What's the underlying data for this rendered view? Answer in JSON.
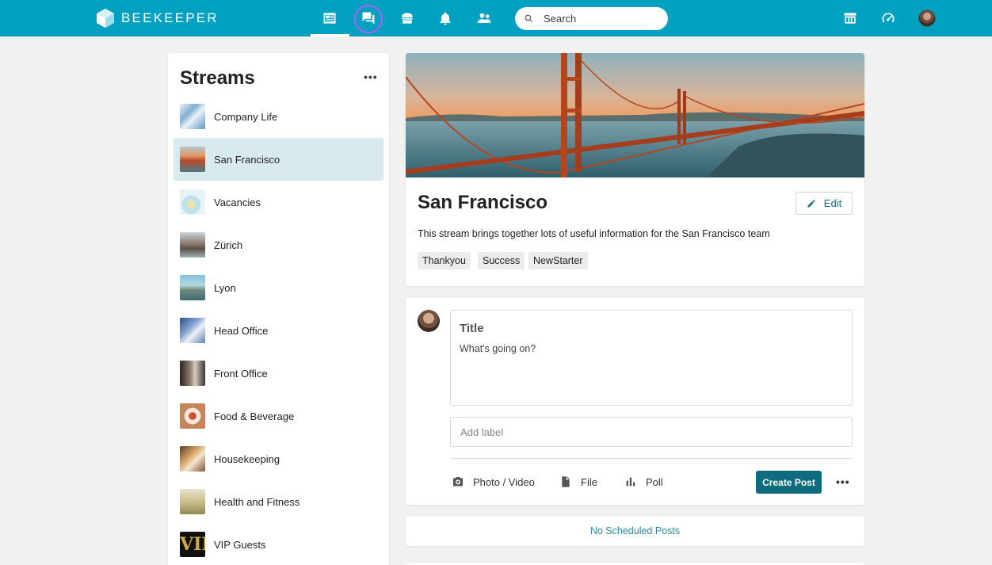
{
  "app": {
    "brand": "BEEKEEPER",
    "colors": {
      "topbar": "#00a1c0",
      "accent": "#0f6c7e",
      "selected_row": "#d9eaee",
      "highlight_ring": "#b65cf2"
    }
  },
  "topbar": {
    "nav_icons": [
      "news-feed-icon",
      "chat-icon",
      "store-icon",
      "bell-icon",
      "people-icon"
    ],
    "search_placeholder": "Search",
    "right_icons": [
      "apps-icon",
      "dashboard-icon",
      "avatar"
    ]
  },
  "streams": {
    "title": "Streams",
    "more_label": "•••",
    "items": [
      {
        "label": "Company Life",
        "selected": false
      },
      {
        "label": "San Francisco",
        "selected": true
      },
      {
        "label": "Vacancies",
        "selected": false
      },
      {
        "label": "Zürich",
        "selected": false
      },
      {
        "label": "Lyon",
        "selected": false
      },
      {
        "label": "Head Office",
        "selected": false
      },
      {
        "label": "Front Office",
        "selected": false
      },
      {
        "label": "Food & Beverage",
        "selected": false
      },
      {
        "label": "Housekeeping",
        "selected": false
      },
      {
        "label": "Health and Fitness",
        "selected": false
      },
      {
        "label": "VIP Guests",
        "selected": false
      }
    ]
  },
  "stream_header": {
    "title": "San Francisco",
    "edit_label": "Edit",
    "description": "This stream brings together lots of useful information for the San Francisco team",
    "tags": [
      "Thankyou",
      "Success",
      "NewStarter"
    ]
  },
  "composer": {
    "title_placeholder": "Title",
    "body_placeholder": "What's going on?",
    "label_placeholder": "Add label",
    "tools": [
      "Photo / Video",
      "File",
      "Poll"
    ],
    "create_label": "Create Post",
    "more_label": "•••"
  },
  "scheduled": {
    "label": "No Scheduled Posts"
  }
}
